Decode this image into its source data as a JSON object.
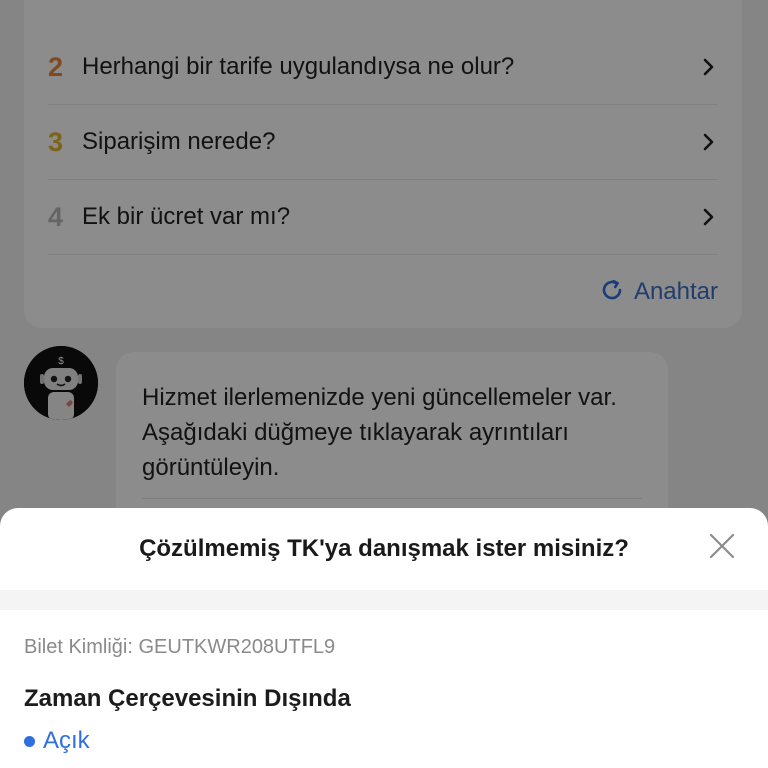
{
  "faq": {
    "items": [
      {
        "num": "2",
        "text": "Herhangi bir tarife uygulandıysa ne olur?",
        "color": "#e8883a"
      },
      {
        "num": "3",
        "text": "Siparişim nerede?",
        "color": "#e0b52b"
      },
      {
        "num": "4",
        "text": "Ek bir ücret var mı?",
        "color": "#b9b9b9"
      }
    ],
    "switch_label": "Anahtar"
  },
  "chat": {
    "bot_message": "Hizmet ilerlemenizde yeni güncellemeler var. Aşağıdaki düğmeye tıklayarak ayrıntıları görüntüleyin."
  },
  "sheet": {
    "title": "Çözülmemiş TK'ya danışmak ister misiniz?",
    "ticket_id_label": "Bilet Kimliği: GEUTKWR208UTFL9",
    "ticket_title": "Zaman Çerçevesinin Dışında",
    "status": "Açık",
    "status_color": "#2f6fde"
  },
  "icons": {
    "chevron": "chevron-right-icon",
    "refresh": "refresh-icon",
    "close": "close-icon",
    "bot": "robot-avatar-icon"
  }
}
